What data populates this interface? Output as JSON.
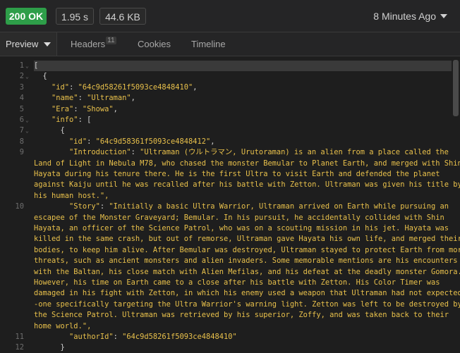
{
  "status": {
    "code": "200 OK",
    "time": "1.95 s",
    "size": "44.6 KB",
    "history": "8 Minutes Ago",
    "status_color": "#2e9e49"
  },
  "tabs": {
    "preview": "Preview",
    "headers": "Headers",
    "headers_count": "11",
    "cookies": "Cookies",
    "timeline": "Timeline"
  },
  "code": {
    "lines": [
      {
        "n": "1",
        "fold": "⌄",
        "t": "["
      },
      {
        "n": "2",
        "fold": "⌄",
        "t": "  {"
      },
      {
        "n": "3",
        "fold": "",
        "key": "\"id\"",
        "val": "\"64c9d58261f5093ce4848410\"",
        "indent": "    ",
        "tail": ","
      },
      {
        "n": "4",
        "fold": "",
        "key": "\"name\"",
        "val": "\"Ultraman\"",
        "indent": "    ",
        "tail": ","
      },
      {
        "n": "5",
        "fold": "",
        "key": "\"Era\"",
        "val": "\"Showa\"",
        "indent": "    ",
        "tail": ","
      },
      {
        "n": "6",
        "fold": "⌄",
        "key": "\"info\"",
        "val": "[",
        "indent": "    ",
        "tail": ""
      },
      {
        "n": "7",
        "fold": "⌄",
        "t": "      {"
      },
      {
        "n": "8",
        "fold": "",
        "key": "\"id\"",
        "val": "\"64c9d58361f5093ce4848412\"",
        "indent": "        ",
        "tail": ","
      },
      {
        "n": "9",
        "fold": "",
        "key": "\"Introduction\"",
        "val": "\"Ultraman (ウルトラマン, Urutoraman) is an alien from a place called the",
        "indent": "        ",
        "tail": ""
      },
      {
        "n": "",
        "wrap": "Land of Light in Nebula M78, who chased the monster Bemular to Planet Earth, and merged with Shin"
      },
      {
        "n": "",
        "wrap": "Hayata during his tenure there. He is the first Ultra to visit Earth and defended the planet"
      },
      {
        "n": "",
        "wrap": "against Kaiju until he was recalled after his battle with Zetton. Ultraman was given his title by"
      },
      {
        "n": "",
        "wrap": "his human host.\","
      },
      {
        "n": "10",
        "fold": "",
        "key": "\"Story\"",
        "val": "\"Initially a basic Ultra Warrior, Ultraman arrived on Earth while pursuing an",
        "indent": "        ",
        "tail": ""
      },
      {
        "n": "",
        "wrap": "escapee of the Monster Graveyard; Bemular. In his pursuit, he accidentally collided with Shin"
      },
      {
        "n": "",
        "wrap": "Hayata, an officer of the Science Patrol, who was on a scouting mission in his jet. Hayata was"
      },
      {
        "n": "",
        "wrap": "killed in the same crash, but out of remorse, Ultraman gave Hayata his own life, and merged their"
      },
      {
        "n": "",
        "wrap": "bodies, to keep him alive. After Bemular was destroyed, Ultraman stayed to protect Earth from more"
      },
      {
        "n": "",
        "wrap": "threats, such as ancient monsters and alien invaders. Some memorable mentions are his encounters"
      },
      {
        "n": "",
        "wrap": "with the Baltan, his close match with Alien Mefilas, and his defeat at the deadly monster Gomora."
      },
      {
        "n": "",
        "wrap": "However, his time on Earth came to a close after his battle with Zetton. His Color Timer was"
      },
      {
        "n": "",
        "wrap": "damaged in his fight with Zetton, in which his enemy used a weapon that Ultraman had not expected-"
      },
      {
        "n": "",
        "wrap": "-one specifically targeting the Ultra Warrior's warning light. Zetton was left to be destroyed by"
      },
      {
        "n": "",
        "wrap": "the Science Patrol. Ultraman was retrieved by his superior, Zoffy, and was taken back to their"
      },
      {
        "n": "",
        "wrap": "home world.\","
      },
      {
        "n": "11",
        "fold": "",
        "key": "\"authorId\"",
        "val": "\"64c9d58261f5093ce4848410\"",
        "indent": "        ",
        "tail": ""
      },
      {
        "n": "12",
        "fold": "",
        "t": "      }"
      }
    ]
  }
}
